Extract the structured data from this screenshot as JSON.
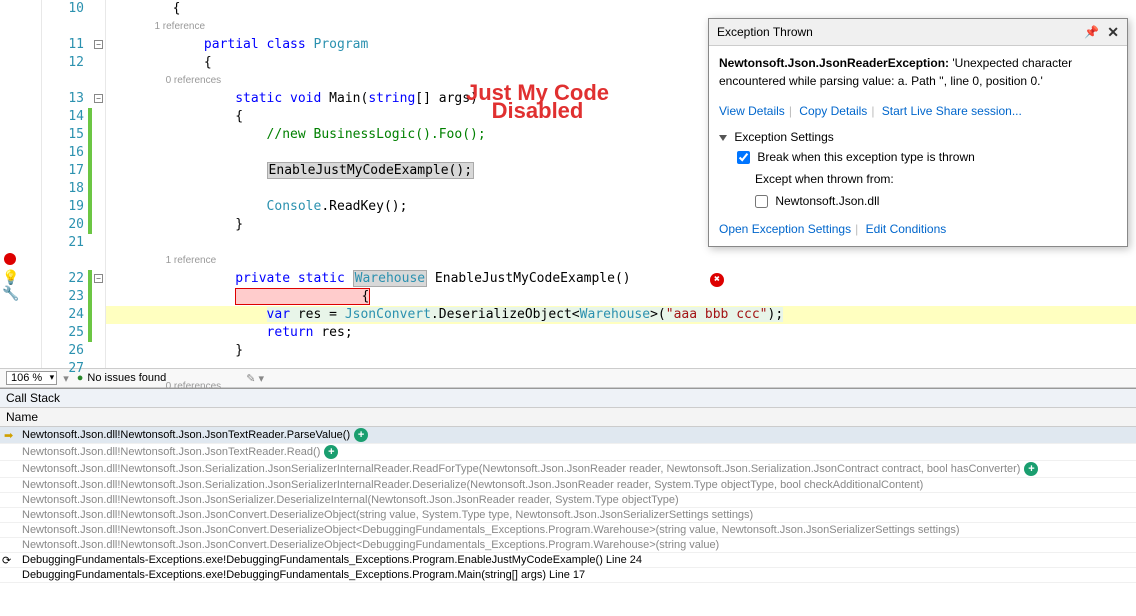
{
  "annotation": {
    "line1": "Just My Code",
    "line2": "Disabled"
  },
  "code": {
    "file_start_line": 10,
    "codelens": {
      "ref1": "1 reference",
      "ref0": "0 references"
    },
    "lines": {
      "l10": "        {",
      "l11_a": "            ",
      "l11_kw1": "partial",
      "l11_b": " ",
      "l11_kw2": "class",
      "l11_c": " ",
      "l11_typ": "Program",
      "l12": "            {",
      "l13_a": "                ",
      "l13_kw1": "static",
      "l13_b": " ",
      "l13_kw2": "void",
      "l13_c": " Main(",
      "l13_kw3": "string",
      "l13_d": "[] args)",
      "l14": "                {",
      "l15_a": "                    ",
      "l15_com": "//new BusinessLogic().Foo();",
      "l16": "",
      "l17_a": "                    ",
      "l17_call": "EnableJustMyCodeExample();",
      "l18": "",
      "l19_a": "                    ",
      "l19_typ": "Console",
      "l19_b": ".ReadKey();",
      "l20": "                }",
      "l21": "",
      "l22_a": "                ",
      "l22_kw1": "private",
      "l22_b": " ",
      "l22_kw2": "static",
      "l22_c": " ",
      "l22_typ": "Warehouse",
      "l22_d": " EnableJustMyCodeExample()",
      "l23": "                {",
      "l24_a": "                    ",
      "l24_kw": "var",
      "l24_b": " res = ",
      "l24_typ1": "JsonConvert",
      "l24_c": ".DeserializeObject<",
      "l24_typ2": "Warehouse",
      "l24_d": ">(",
      "l24_str": "\"aaa bbb ccc\"",
      "l24_e": ");",
      "l25_a": "                    ",
      "l25_kw": "return",
      "l25_b": " res;",
      "l26": "                }",
      "l27": ""
    }
  },
  "exception": {
    "title": "Exception Thrown",
    "type": "Newtonsoft.Json.JsonReaderException:",
    "message": " 'Unexpected character encountered while parsing value: a. Path '', line 0, position 0.'",
    "view_details": "View Details",
    "copy_details": "Copy Details",
    "live_share": "Start Live Share session...",
    "settings_header": "Exception Settings",
    "break_when": "Break when this exception type is thrown",
    "except_from": "Except when thrown from:",
    "except_dll": "Newtonsoft.Json.dll",
    "open_settings": "Open Exception Settings",
    "edit_conditions": "Edit Conditions"
  },
  "status": {
    "zoom": "106 %",
    "issues": "No issues found"
  },
  "callstack": {
    "title": "Call Stack",
    "header": "Name",
    "frames": [
      "Newtonsoft.Json.dll!Newtonsoft.Json.JsonTextReader.ParseValue()",
      "Newtonsoft.Json.dll!Newtonsoft.Json.JsonTextReader.Read()",
      "Newtonsoft.Json.dll!Newtonsoft.Json.Serialization.JsonSerializerInternalReader.ReadForType(Newtonsoft.Json.JsonReader reader, Newtonsoft.Json.Serialization.JsonContract contract, bool hasConverter)",
      "Newtonsoft.Json.dll!Newtonsoft.Json.Serialization.JsonSerializerInternalReader.Deserialize(Newtonsoft.Json.JsonReader reader, System.Type objectType, bool checkAdditionalContent)",
      "Newtonsoft.Json.dll!Newtonsoft.Json.JsonSerializer.DeserializeInternal(Newtonsoft.Json.JsonReader reader, System.Type objectType)",
      "Newtonsoft.Json.dll!Newtonsoft.Json.JsonConvert.DeserializeObject(string value, System.Type type, Newtonsoft.Json.JsonSerializerSettings settings)",
      "Newtonsoft.Json.dll!Newtonsoft.Json.JsonConvert.DeserializeObject<DebuggingFundamentals_Exceptions.Program.Warehouse>(string value, Newtonsoft.Json.JsonSerializerSettings settings)",
      "Newtonsoft.Json.dll!Newtonsoft.Json.JsonConvert.DeserializeObject<DebuggingFundamentals_Exceptions.Program.Warehouse>(string value)",
      "DebuggingFundamentals-Exceptions.exe!DebuggingFundamentals_Exceptions.Program.EnableJustMyCodeExample() Line 24",
      "DebuggingFundamentals-Exceptions.exe!DebuggingFundamentals_Exceptions.Program.Main(string[] args) Line 17"
    ]
  }
}
